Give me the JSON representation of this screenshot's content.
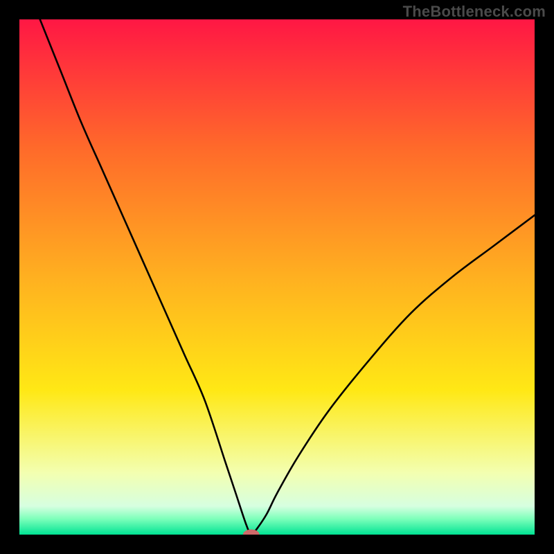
{
  "watermark": "TheBottleneck.com",
  "chart_data": {
    "type": "line",
    "title": "",
    "xlabel": "",
    "ylabel": "",
    "xlim": [
      0,
      100
    ],
    "ylim": [
      0,
      100
    ],
    "grid": false,
    "legend": false,
    "background_gradient_stops": [
      {
        "offset": 0.0,
        "color": "#ff1744"
      },
      {
        "offset": 0.25,
        "color": "#ff6a2a"
      },
      {
        "offset": 0.5,
        "color": "#ffb020"
      },
      {
        "offset": 0.72,
        "color": "#ffe815"
      },
      {
        "offset": 0.88,
        "color": "#f3ffb0"
      },
      {
        "offset": 0.945,
        "color": "#d6ffe0"
      },
      {
        "offset": 0.97,
        "color": "#7bffba"
      },
      {
        "offset": 1.0,
        "color": "#00e393"
      }
    ],
    "marker": {
      "x": 45.0,
      "y": 0.0,
      "color": "#cf6a6a",
      "rx": 1.6,
      "ry": 1.0
    },
    "series": [
      {
        "name": "curve",
        "x": [
          4,
          8,
          12,
          16,
          20,
          24,
          28,
          32,
          36,
          40,
          42,
          44,
          45,
          46,
          48,
          50,
          54,
          60,
          68,
          76,
          84,
          92,
          100
        ],
        "y": [
          100,
          90,
          80,
          71,
          62,
          53,
          44,
          35,
          26,
          14,
          8,
          2,
          0,
          1,
          4,
          8,
          15,
          24,
          34,
          43,
          50,
          56,
          62
        ]
      }
    ]
  }
}
